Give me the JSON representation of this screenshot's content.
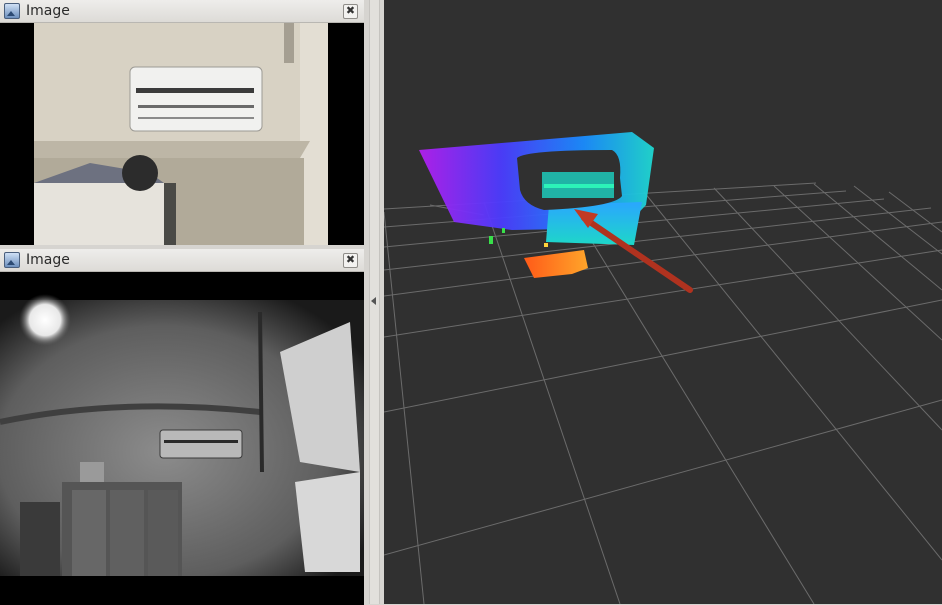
{
  "panels": [
    {
      "title": "Image",
      "close_label": "✖"
    },
    {
      "title": "Image",
      "close_label": "✖"
    }
  ],
  "colors": {
    "background_3d": "#303030",
    "grid": "#6e6e6e",
    "arrow": "#b0321f"
  },
  "icons": {
    "panel_icon": "image-icon",
    "close": "close-icon",
    "splitter": "chevron-left-icon"
  }
}
